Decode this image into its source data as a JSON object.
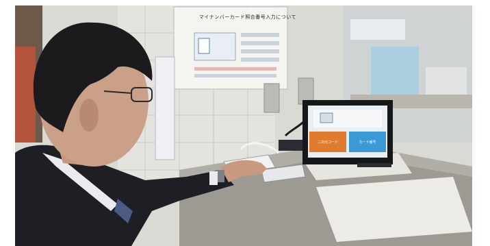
{
  "poster": {
    "title": "マイナンバーカード照合番号入力について"
  },
  "tablet": {
    "left_button_label": "二次元コード",
    "right_button_label": "カード番号"
  },
  "colors": {
    "tablet_left_button": "#e07a2c",
    "tablet_right_button": "#3a9ad6",
    "counter_granite": "#9c9a93",
    "suit": "#1d1f24"
  }
}
